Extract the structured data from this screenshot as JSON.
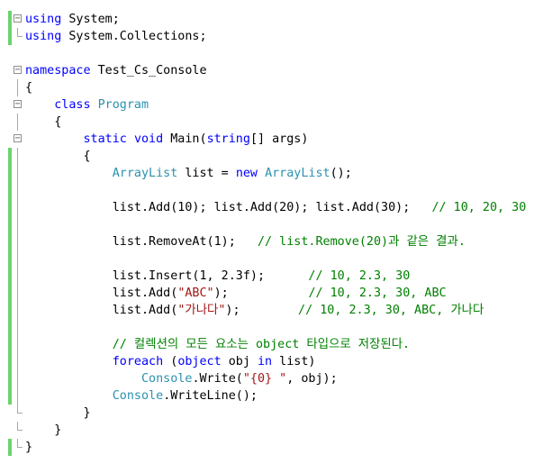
{
  "colors": {
    "keyword": "#0000ff",
    "type": "#2b91af",
    "string": "#a31515",
    "comment": "#008000",
    "text": "#000000",
    "changed_bar": "#6cd36c"
  },
  "lines": [
    {
      "fold": "box",
      "bar": true,
      "tokens": [
        {
          "t": "using",
          "k": "kw"
        },
        {
          "t": " System;",
          "k": "tx"
        }
      ]
    },
    {
      "fold": "end",
      "bar": true,
      "tokens": [
        {
          "t": "using",
          "k": "kw"
        },
        {
          "t": " System.Collections;",
          "k": "tx"
        }
      ]
    },
    {
      "fold": "none",
      "bar": false,
      "tokens": []
    },
    {
      "fold": "box",
      "bar": false,
      "tokens": [
        {
          "t": "namespace",
          "k": "kw"
        },
        {
          "t": " Test_Cs_Console",
          "k": "tx"
        }
      ]
    },
    {
      "fold": "line",
      "bar": false,
      "tokens": [
        {
          "t": "{",
          "k": "tx"
        }
      ]
    },
    {
      "fold": "box",
      "bar": false,
      "tokens": [
        {
          "t": "    ",
          "k": "tx"
        },
        {
          "t": "class",
          "k": "kw"
        },
        {
          "t": " ",
          "k": "tx"
        },
        {
          "t": "Program",
          "k": "ty"
        }
      ]
    },
    {
      "fold": "line",
      "bar": false,
      "tokens": [
        {
          "t": "    {",
          "k": "tx"
        }
      ]
    },
    {
      "fold": "box",
      "bar": false,
      "tokens": [
        {
          "t": "        ",
          "k": "tx"
        },
        {
          "t": "static",
          "k": "kw"
        },
        {
          "t": " ",
          "k": "tx"
        },
        {
          "t": "void",
          "k": "kw"
        },
        {
          "t": " Main(",
          "k": "tx"
        },
        {
          "t": "string",
          "k": "kw"
        },
        {
          "t": "[] args)",
          "k": "tx"
        }
      ]
    },
    {
      "fold": "line",
      "bar": true,
      "tokens": [
        {
          "t": "        {",
          "k": "tx"
        }
      ]
    },
    {
      "fold": "line",
      "bar": true,
      "tokens": [
        {
          "t": "            ",
          "k": "tx"
        },
        {
          "t": "ArrayList",
          "k": "ty"
        },
        {
          "t": " list = ",
          "k": "tx"
        },
        {
          "t": "new",
          "k": "kw"
        },
        {
          "t": " ",
          "k": "tx"
        },
        {
          "t": "ArrayList",
          "k": "ty"
        },
        {
          "t": "();",
          "k": "tx"
        }
      ]
    },
    {
      "fold": "line",
      "bar": true,
      "tokens": []
    },
    {
      "fold": "line",
      "bar": true,
      "tokens": [
        {
          "t": "            list.Add(10); list.Add(20); list.Add(30);   ",
          "k": "tx"
        },
        {
          "t": "// 10, 20, 30",
          "k": "cm"
        }
      ]
    },
    {
      "fold": "line",
      "bar": true,
      "tokens": []
    },
    {
      "fold": "line",
      "bar": true,
      "tokens": [
        {
          "t": "            list.RemoveAt(1);   ",
          "k": "tx"
        },
        {
          "t": "// list.Remove(20)과 같은 결과.",
          "k": "cm"
        }
      ]
    },
    {
      "fold": "line",
      "bar": true,
      "tokens": []
    },
    {
      "fold": "line",
      "bar": true,
      "tokens": [
        {
          "t": "            list.Insert(1, 2.3f);      ",
          "k": "tx"
        },
        {
          "t": "// 10, 2.3, 30",
          "k": "cm"
        }
      ]
    },
    {
      "fold": "line",
      "bar": true,
      "tokens": [
        {
          "t": "            list.Add(",
          "k": "tx"
        },
        {
          "t": "\"ABC\"",
          "k": "st"
        },
        {
          "t": ");           ",
          "k": "tx"
        },
        {
          "t": "// 10, 2.3, 30, ABC",
          "k": "cm"
        }
      ]
    },
    {
      "fold": "line",
      "bar": true,
      "tokens": [
        {
          "t": "            list.Add(",
          "k": "tx"
        },
        {
          "t": "\"가나다\"",
          "k": "st"
        },
        {
          "t": ");        ",
          "k": "tx"
        },
        {
          "t": "// 10, 2.3, 30, ABC, 가나다",
          "k": "cm"
        }
      ]
    },
    {
      "fold": "line",
      "bar": true,
      "tokens": []
    },
    {
      "fold": "line",
      "bar": true,
      "tokens": [
        {
          "t": "            ",
          "k": "tx"
        },
        {
          "t": "// 컬렉션의 모든 요소는 object 타입으로 저장된다.",
          "k": "cm"
        }
      ]
    },
    {
      "fold": "line",
      "bar": true,
      "tokens": [
        {
          "t": "            ",
          "k": "tx"
        },
        {
          "t": "foreach",
          "k": "kw"
        },
        {
          "t": " (",
          "k": "tx"
        },
        {
          "t": "object",
          "k": "kw"
        },
        {
          "t": " obj ",
          "k": "tx"
        },
        {
          "t": "in",
          "k": "kw"
        },
        {
          "t": " list)",
          "k": "tx"
        }
      ]
    },
    {
      "fold": "line",
      "bar": true,
      "tokens": [
        {
          "t": "                ",
          "k": "tx"
        },
        {
          "t": "Console",
          "k": "ty"
        },
        {
          "t": ".Write(",
          "k": "tx"
        },
        {
          "t": "\"{0} \"",
          "k": "st"
        },
        {
          "t": ", obj);",
          "k": "tx"
        }
      ]
    },
    {
      "fold": "line",
      "bar": true,
      "tokens": [
        {
          "t": "            ",
          "k": "tx"
        },
        {
          "t": "Console",
          "k": "ty"
        },
        {
          "t": ".WriteLine();",
          "k": "tx"
        }
      ]
    },
    {
      "fold": "end",
      "bar": false,
      "tokens": [
        {
          "t": "        }",
          "k": "tx"
        }
      ]
    },
    {
      "fold": "end",
      "bar": false,
      "tokens": [
        {
          "t": "    }",
          "k": "tx"
        }
      ]
    },
    {
      "fold": "end",
      "bar": true,
      "tokens": [
        {
          "t": "}",
          "k": "tx"
        }
      ]
    }
  ]
}
